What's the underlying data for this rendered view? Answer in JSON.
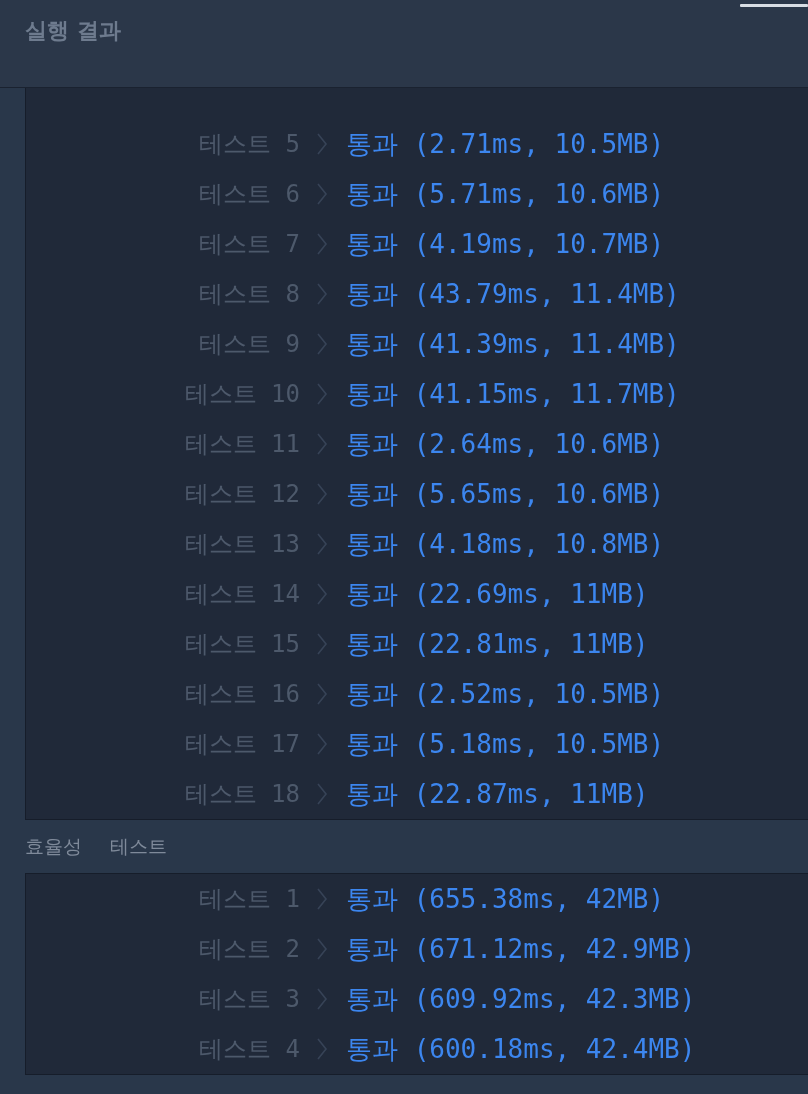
{
  "title": "실행 결과",
  "sections": [
    {
      "rows": [
        {
          "label": "테스트 5",
          "status": "통과",
          "detail": "(2.71ms, 10.5MB)"
        },
        {
          "label": "테스트 6",
          "status": "통과",
          "detail": "(5.71ms, 10.6MB)"
        },
        {
          "label": "테스트 7",
          "status": "통과",
          "detail": "(4.19ms, 10.7MB)"
        },
        {
          "label": "테스트 8",
          "status": "통과",
          "detail": "(43.79ms, 11.4MB)"
        },
        {
          "label": "테스트 9",
          "status": "통과",
          "detail": "(41.39ms, 11.4MB)"
        },
        {
          "label": "테스트 10",
          "status": "통과",
          "detail": "(41.15ms, 11.7MB)"
        },
        {
          "label": "테스트 11",
          "status": "통과",
          "detail": "(2.64ms, 10.6MB)"
        },
        {
          "label": "테스트 12",
          "status": "통과",
          "detail": "(5.65ms, 10.6MB)"
        },
        {
          "label": "테스트 13",
          "status": "통과",
          "detail": "(4.18ms, 10.8MB)"
        },
        {
          "label": "테스트 14",
          "status": "통과",
          "detail": "(22.69ms, 11MB)"
        },
        {
          "label": "테스트 15",
          "status": "통과",
          "detail": "(22.81ms, 11MB)"
        },
        {
          "label": "테스트 16",
          "status": "통과",
          "detail": "(2.52ms, 10.5MB)"
        },
        {
          "label": "테스트 17",
          "status": "통과",
          "detail": "(5.18ms, 10.5MB)"
        },
        {
          "label": "테스트 18",
          "status": "통과",
          "detail": "(22.87ms, 11MB)"
        }
      ]
    },
    {
      "heading": "효율성 테스트",
      "rows": [
        {
          "label": "테스트 1",
          "status": "통과",
          "detail": "(655.38ms, 42MB)"
        },
        {
          "label": "테스트 2",
          "status": "통과",
          "detail": "(671.12ms, 42.9MB)"
        },
        {
          "label": "테스트 3",
          "status": "통과",
          "detail": "(609.92ms, 42.3MB)"
        },
        {
          "label": "테스트 4",
          "status": "통과",
          "detail": "(600.18ms, 42.4MB)"
        }
      ]
    }
  ]
}
